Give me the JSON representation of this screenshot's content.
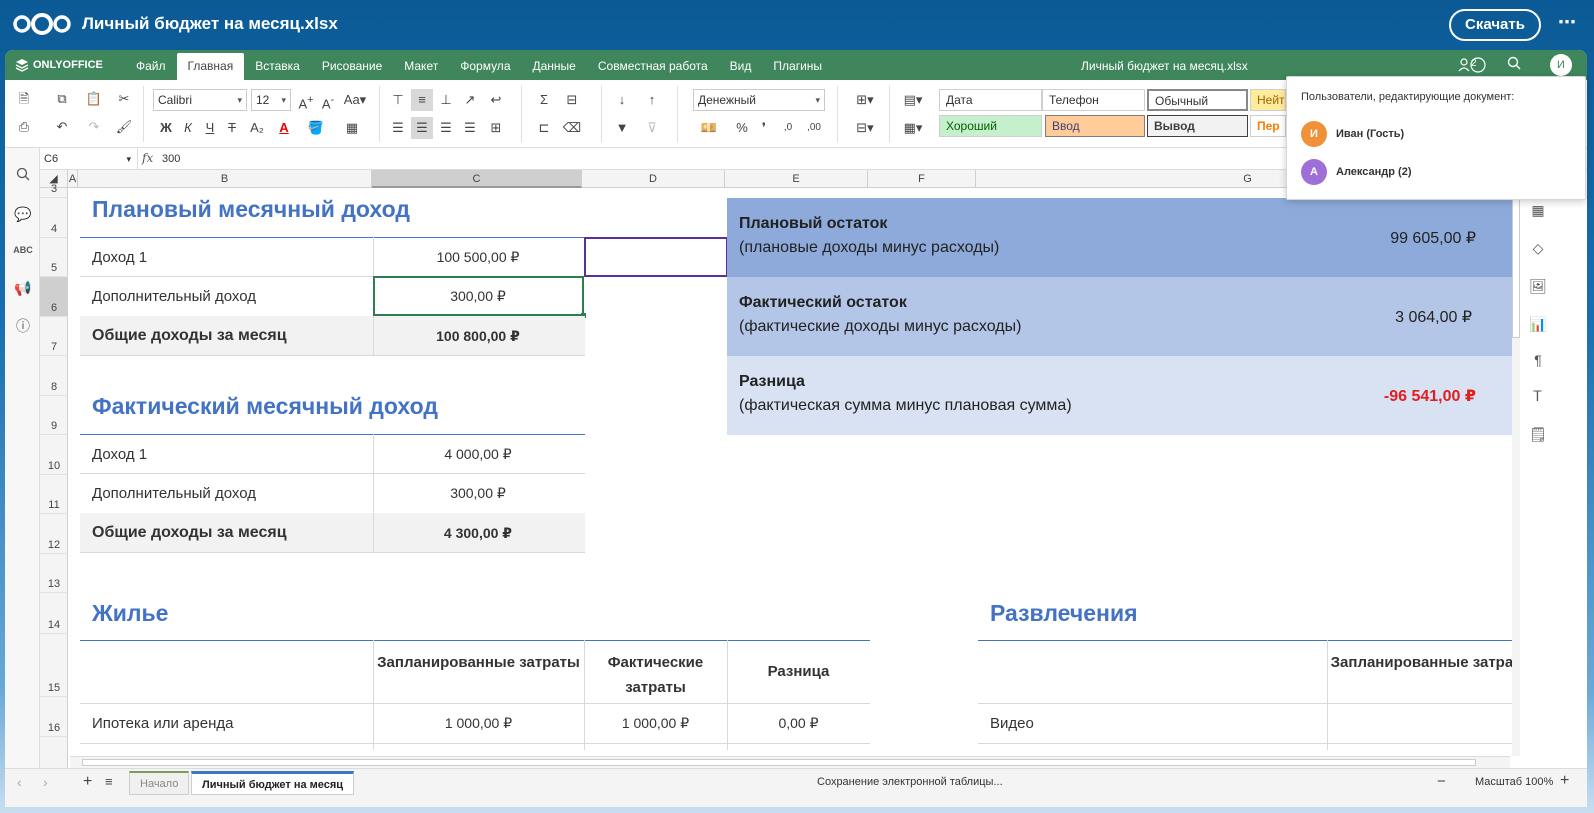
{
  "nextcloud": {
    "file_title": "Личный бюджет на месяц.xlsx",
    "download_label": "Скачать",
    "more_label": "⋯"
  },
  "onlyoffice": {
    "logo_text": "ONLYOFFICE",
    "tabs": [
      "Файл",
      "Главная",
      "Вставка",
      "Рисование",
      "Макет",
      "Формула",
      "Данные",
      "Совместная работа",
      "Вид",
      "Плагины"
    ],
    "active_tab": "Главная",
    "doc_title": "Личный бюджет на месяц.xlsx",
    "users_count": "2",
    "user_initial": "И"
  },
  "toolbar": {
    "font_name": "Calibri",
    "font_size": "12",
    "number_format": "Денежный",
    "bold": "Ж",
    "italic": "К",
    "underline": "Ч",
    "strike": "Т",
    "subscript": "A₂",
    "font_color": "A",
    "percent": "%",
    "decrease_decimal": ",0",
    "increase_decimal": ",00",
    "styles": {
      "row1": [
        "Дата",
        "Телефон",
        "Обычный",
        "Нейт"
      ],
      "row2": [
        "Хороший",
        "Ввод",
        "Вывод",
        "Пер"
      ]
    }
  },
  "formula_bar": {
    "cell_ref": "C6",
    "fx": "fx",
    "value": "300"
  },
  "columns": [
    "A",
    "B",
    "C",
    "D",
    "E",
    "F",
    "G"
  ],
  "rows": [
    "3",
    "4",
    "5",
    "6",
    "7",
    "8",
    "9",
    "10",
    "11",
    "12",
    "13",
    "14",
    "15",
    "16"
  ],
  "sheet": {
    "planned_income": {
      "title": "Плановый месячный доход",
      "rows": [
        {
          "label": "Доход 1",
          "value": "100 500,00 ₽"
        },
        {
          "label": "Дополнительный доход",
          "value": "300,00 ₽"
        }
      ],
      "total_label": "Общие доходы за месяц",
      "total_value": "100 800,00 ₽"
    },
    "actual_income": {
      "title": "Фактический месячный доход",
      "rows": [
        {
          "label": "Доход 1",
          "value": "4 000,00 ₽"
        },
        {
          "label": "Дополнительный доход",
          "value": "300,00 ₽"
        }
      ],
      "total_label": "Общие доходы за месяц",
      "total_value": "4 300,00 ₽"
    },
    "summary": [
      {
        "title": "Плановый остаток",
        "subtitle": "(плановые доходы минус расходы)",
        "value": "99 605,00 ₽",
        "bg": "#8eaadb"
      },
      {
        "title": "Фактический остаток",
        "subtitle": "(фактические доходы минус расходы)",
        "value": "3 064,00 ₽",
        "bg": "#b4c6e7"
      },
      {
        "title": "Разница",
        "subtitle": "(фактическая сумма минус плановая сумма)",
        "value": "-96 541,00 ₽",
        "bg": "#d9e2f3"
      }
    ],
    "housing": {
      "title": "Жилье",
      "headers": [
        "Запланированные затраты",
        "Фактические затраты",
        "Разница"
      ],
      "row": {
        "label": "Ипотека или аренда",
        "planned": "1 000,00 ₽",
        "actual": "1 000,00 ₽",
        "diff": "0,00 ₽"
      }
    },
    "entertainment": {
      "title": "Развлечения",
      "header": "Запланированные затраты",
      "row_label": "Видео"
    }
  },
  "status": {
    "tabs": [
      "Начало",
      "Личный бюджет на месяц"
    ],
    "active_tab": "Личный бюджет на месяц",
    "message": "Сохранение электронной таблицы...",
    "zoom": "Масштаб 100%"
  },
  "users_popover": {
    "title": "Пользователи, редактирующие документ:",
    "users": [
      {
        "initial": "И",
        "name": "Иван (Гость)",
        "color": "#f0913a"
      },
      {
        "initial": "А",
        "name": "Александр (2)",
        "color": "#9f6fd8"
      }
    ]
  },
  "colors": {
    "accent_blue": "#4472c4",
    "oo_green": "#40865c",
    "negative": "#e01f1f"
  }
}
